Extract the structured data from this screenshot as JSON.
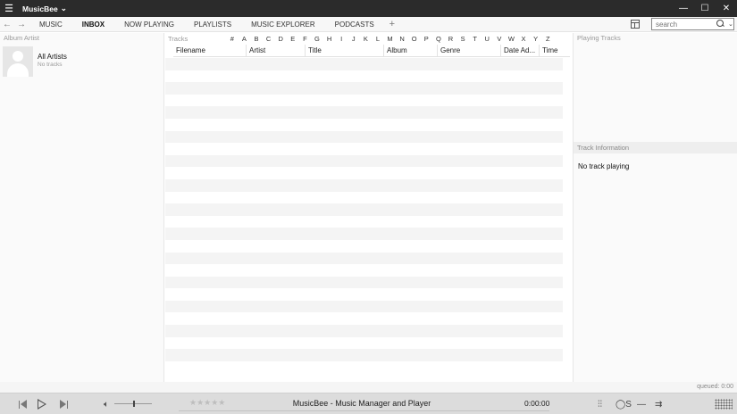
{
  "titlebar": {
    "app_name": "MusicBee",
    "chevron": "chevron-down-icon",
    "menu_icon": "hamburger-icon",
    "window_buttons": [
      "minimize-icon",
      "maximize-icon",
      "close-icon"
    ]
  },
  "nav": {
    "tabs": [
      {
        "label": "MUSIC",
        "active": false
      },
      {
        "label": "INBOX",
        "active": true
      },
      {
        "label": "NOW PLAYING",
        "active": false
      },
      {
        "label": "PLAYLISTS",
        "active": false
      },
      {
        "label": "MUSIC EXPLORER",
        "active": false
      },
      {
        "label": "PODCASTS",
        "active": false
      }
    ],
    "add_tab": "+",
    "search_placeholder": "search"
  },
  "left_panel": {
    "header": "Album Artist",
    "artist": {
      "name": "All Artists",
      "sub": "No tracks"
    }
  },
  "tracks_panel": {
    "header": "Tracks",
    "letters": [
      "#",
      "A",
      "B",
      "C",
      "D",
      "E",
      "F",
      "G",
      "H",
      "I",
      "J",
      "K",
      "L",
      "M",
      "N",
      "O",
      "P",
      "Q",
      "R",
      "S",
      "T",
      "U",
      "V",
      "W",
      "X",
      "Y",
      "Z"
    ],
    "columns": [
      "Filename",
      "Artist",
      "Title",
      "Album",
      "Genre",
      "Date Ad...",
      "Time"
    ]
  },
  "right_panel": {
    "playing_header": "Playing Tracks",
    "info_header": "Track Information",
    "no_track": "No track playing"
  },
  "status": {
    "queued": "queued: 0:00"
  },
  "player": {
    "title": "MusicBee - Music Manager and Player",
    "time": "0:00:00",
    "rating": "★★★★★",
    "volume_level": 0.5
  },
  "colors": {
    "titlebar_bg": "#2b2b2b",
    "player_bg": "#dcdcdc",
    "row_stripe": "#f4f4f4"
  }
}
